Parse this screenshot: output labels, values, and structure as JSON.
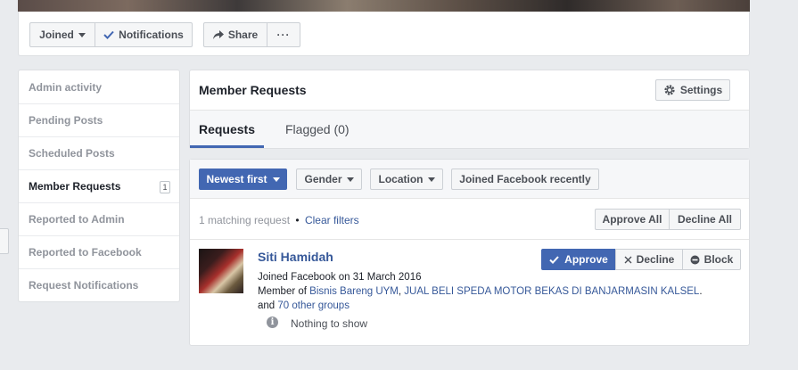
{
  "top": {
    "joined_label": "Joined",
    "notifications_label": "Notifications",
    "share_label": "Share",
    "more_label": "···"
  },
  "sidebar": {
    "items": [
      {
        "label": "Admin activity"
      },
      {
        "label": "Pending Posts"
      },
      {
        "label": "Scheduled Posts"
      },
      {
        "label": "Member Requests",
        "count": "1"
      },
      {
        "label": "Reported to Admin"
      },
      {
        "label": "Reported to Facebook"
      },
      {
        "label": "Request Notifications"
      }
    ]
  },
  "main": {
    "title": "Member Requests",
    "settings_label": "Settings",
    "tabs": [
      {
        "label": "Requests"
      },
      {
        "label": "Flagged (0)"
      }
    ]
  },
  "filters": {
    "sort_label": "Newest first",
    "gender_label": "Gender",
    "location_label": "Location",
    "joined_recently_label": "Joined Facebook recently"
  },
  "results": {
    "matching_text": "1 matching request",
    "separator": "•",
    "clear_filters": "Clear filters",
    "approve_all": "Approve All",
    "decline_all": "Decline All"
  },
  "request": {
    "name": "Siti Hamidah",
    "joined_text": "Joined Facebook on 31 March 2016",
    "member_of_prefix": "Member of ",
    "group1": "Bisnis Bareng UYM",
    "comma": ", ",
    "group2": "JUAL BELI SPEDA MOTOR BEKAS DI BANJARMASIN KALSEL",
    "period": ".",
    "and_text": "and ",
    "other_groups": "70 other groups",
    "nothing_text": "Nothing to show",
    "approve_label": "Approve",
    "decline_label": "Decline",
    "block_label": "Block"
  },
  "colors": {
    "accent": "#4267b2",
    "link": "#365899",
    "background": "#e9ebee"
  }
}
